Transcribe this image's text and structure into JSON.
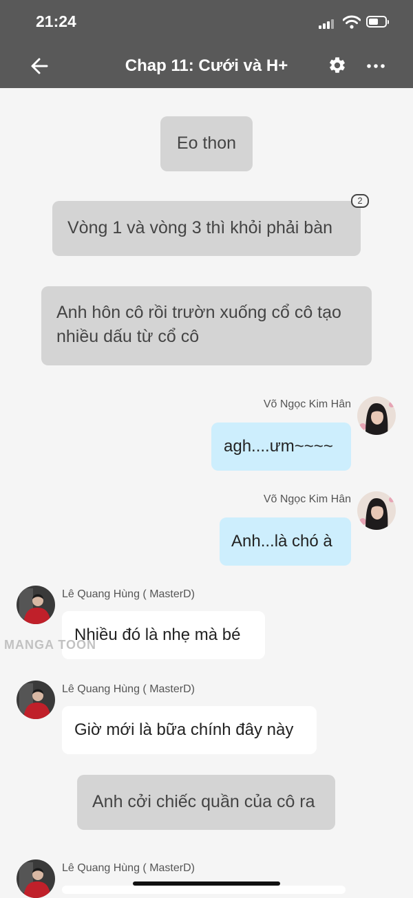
{
  "status_bar": {
    "time": "21:24",
    "battery_fraction": 0.6
  },
  "header": {
    "title": "Chap 11: Cưới và H+"
  },
  "messages": [
    {
      "type": "narration",
      "text": "Eo thon"
    },
    {
      "type": "narration",
      "text": "Vòng 1 và vòng 3 thì khỏi phải bàn",
      "comment_count": "2"
    },
    {
      "type": "narration",
      "text": "Anh hôn cô rồi trườn xuống cổ cô tạo nhiều dấu từ cổ cô"
    },
    {
      "type": "right",
      "author": "Võ Ngọc Kim Hân",
      "text": "agh....ưm~~~~"
    },
    {
      "type": "right",
      "author": "Võ Ngọc Kim Hân",
      "text": "Anh...là chó à"
    },
    {
      "type": "left",
      "author": "Lê Quang Hùng ( MasterD)",
      "text": "Nhiều đó là nhẹ mà bé"
    },
    {
      "type": "left",
      "author": "Lê Quang Hùng ( MasterD)",
      "text": "Giờ mới là bữa chính đây này"
    },
    {
      "type": "narration",
      "text": "Anh cởi chiếc quần của cô ra"
    },
    {
      "type": "left",
      "author": "Lê Quang Hùng ( MasterD)",
      "text": ""
    }
  ],
  "watermark": "MANGA TOON",
  "icons": {
    "back": "arrow-left-icon",
    "settings": "gear-icon",
    "more": "more-horizontal-icon",
    "comment": "comment-count-icon"
  },
  "colors": {
    "header_bg": "#595959",
    "narration_bg": "#d4d4d4",
    "right_bubble_bg": "#cdeefd",
    "left_bubble_bg": "#ffffff",
    "page_bg": "#f5f5f5"
  }
}
